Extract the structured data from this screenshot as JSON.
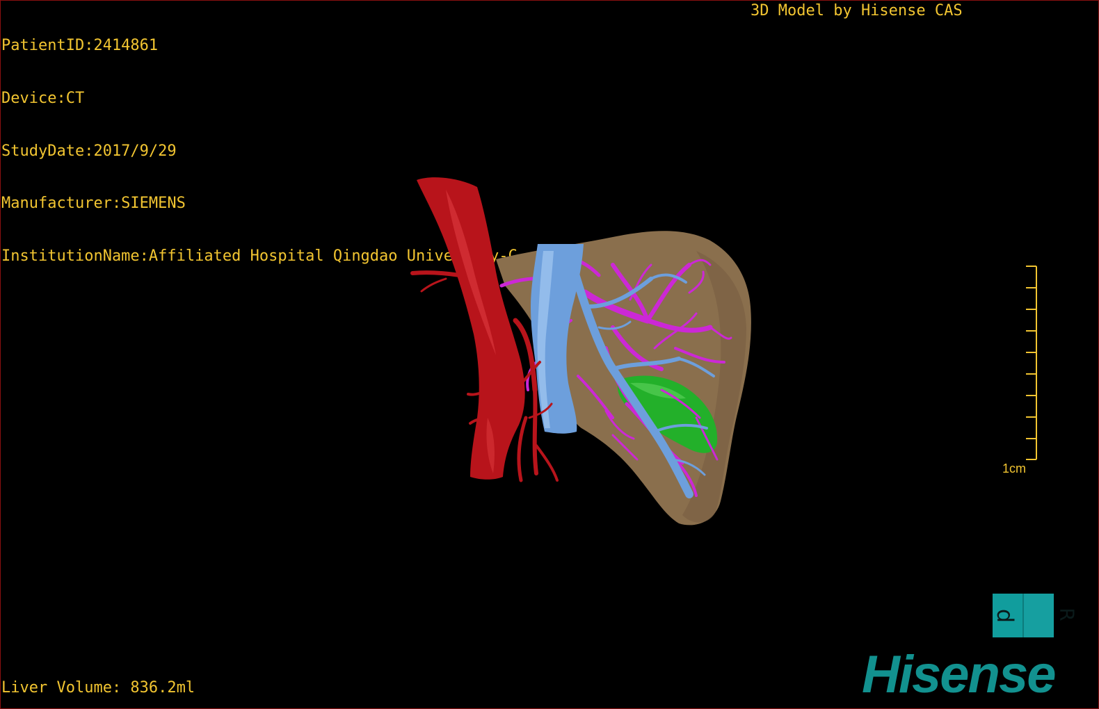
{
  "viewer": {
    "info_lines": [
      "PatientID:2414861",
      "Device:CT",
      "StudyDate:2017/9/29",
      "Manufacturer:SIEMENS",
      "InstitutionName:Affiliated Hospital Qingdao University-C"
    ],
    "credit": "3D Model by Hisense CAS",
    "liver_volume": "Liver Volume: 836.2ml",
    "scale_label": "1cm",
    "orientation": {
      "left_glyph": "d",
      "right_glyph": "R"
    },
    "brand": "Hisense"
  },
  "colors": {
    "overlay_text": "#f2c531",
    "aorta": "#b8141b",
    "vena_cava": "#6d9fdc",
    "portal_vessels": "#cc28d6",
    "liver": "#8a6f4d",
    "gallbladder": "#23b02a",
    "brand": "#12918f",
    "border": "#8a1010"
  },
  "icons": [
    "orientation-cube-icon",
    "scale-bar-icon"
  ]
}
